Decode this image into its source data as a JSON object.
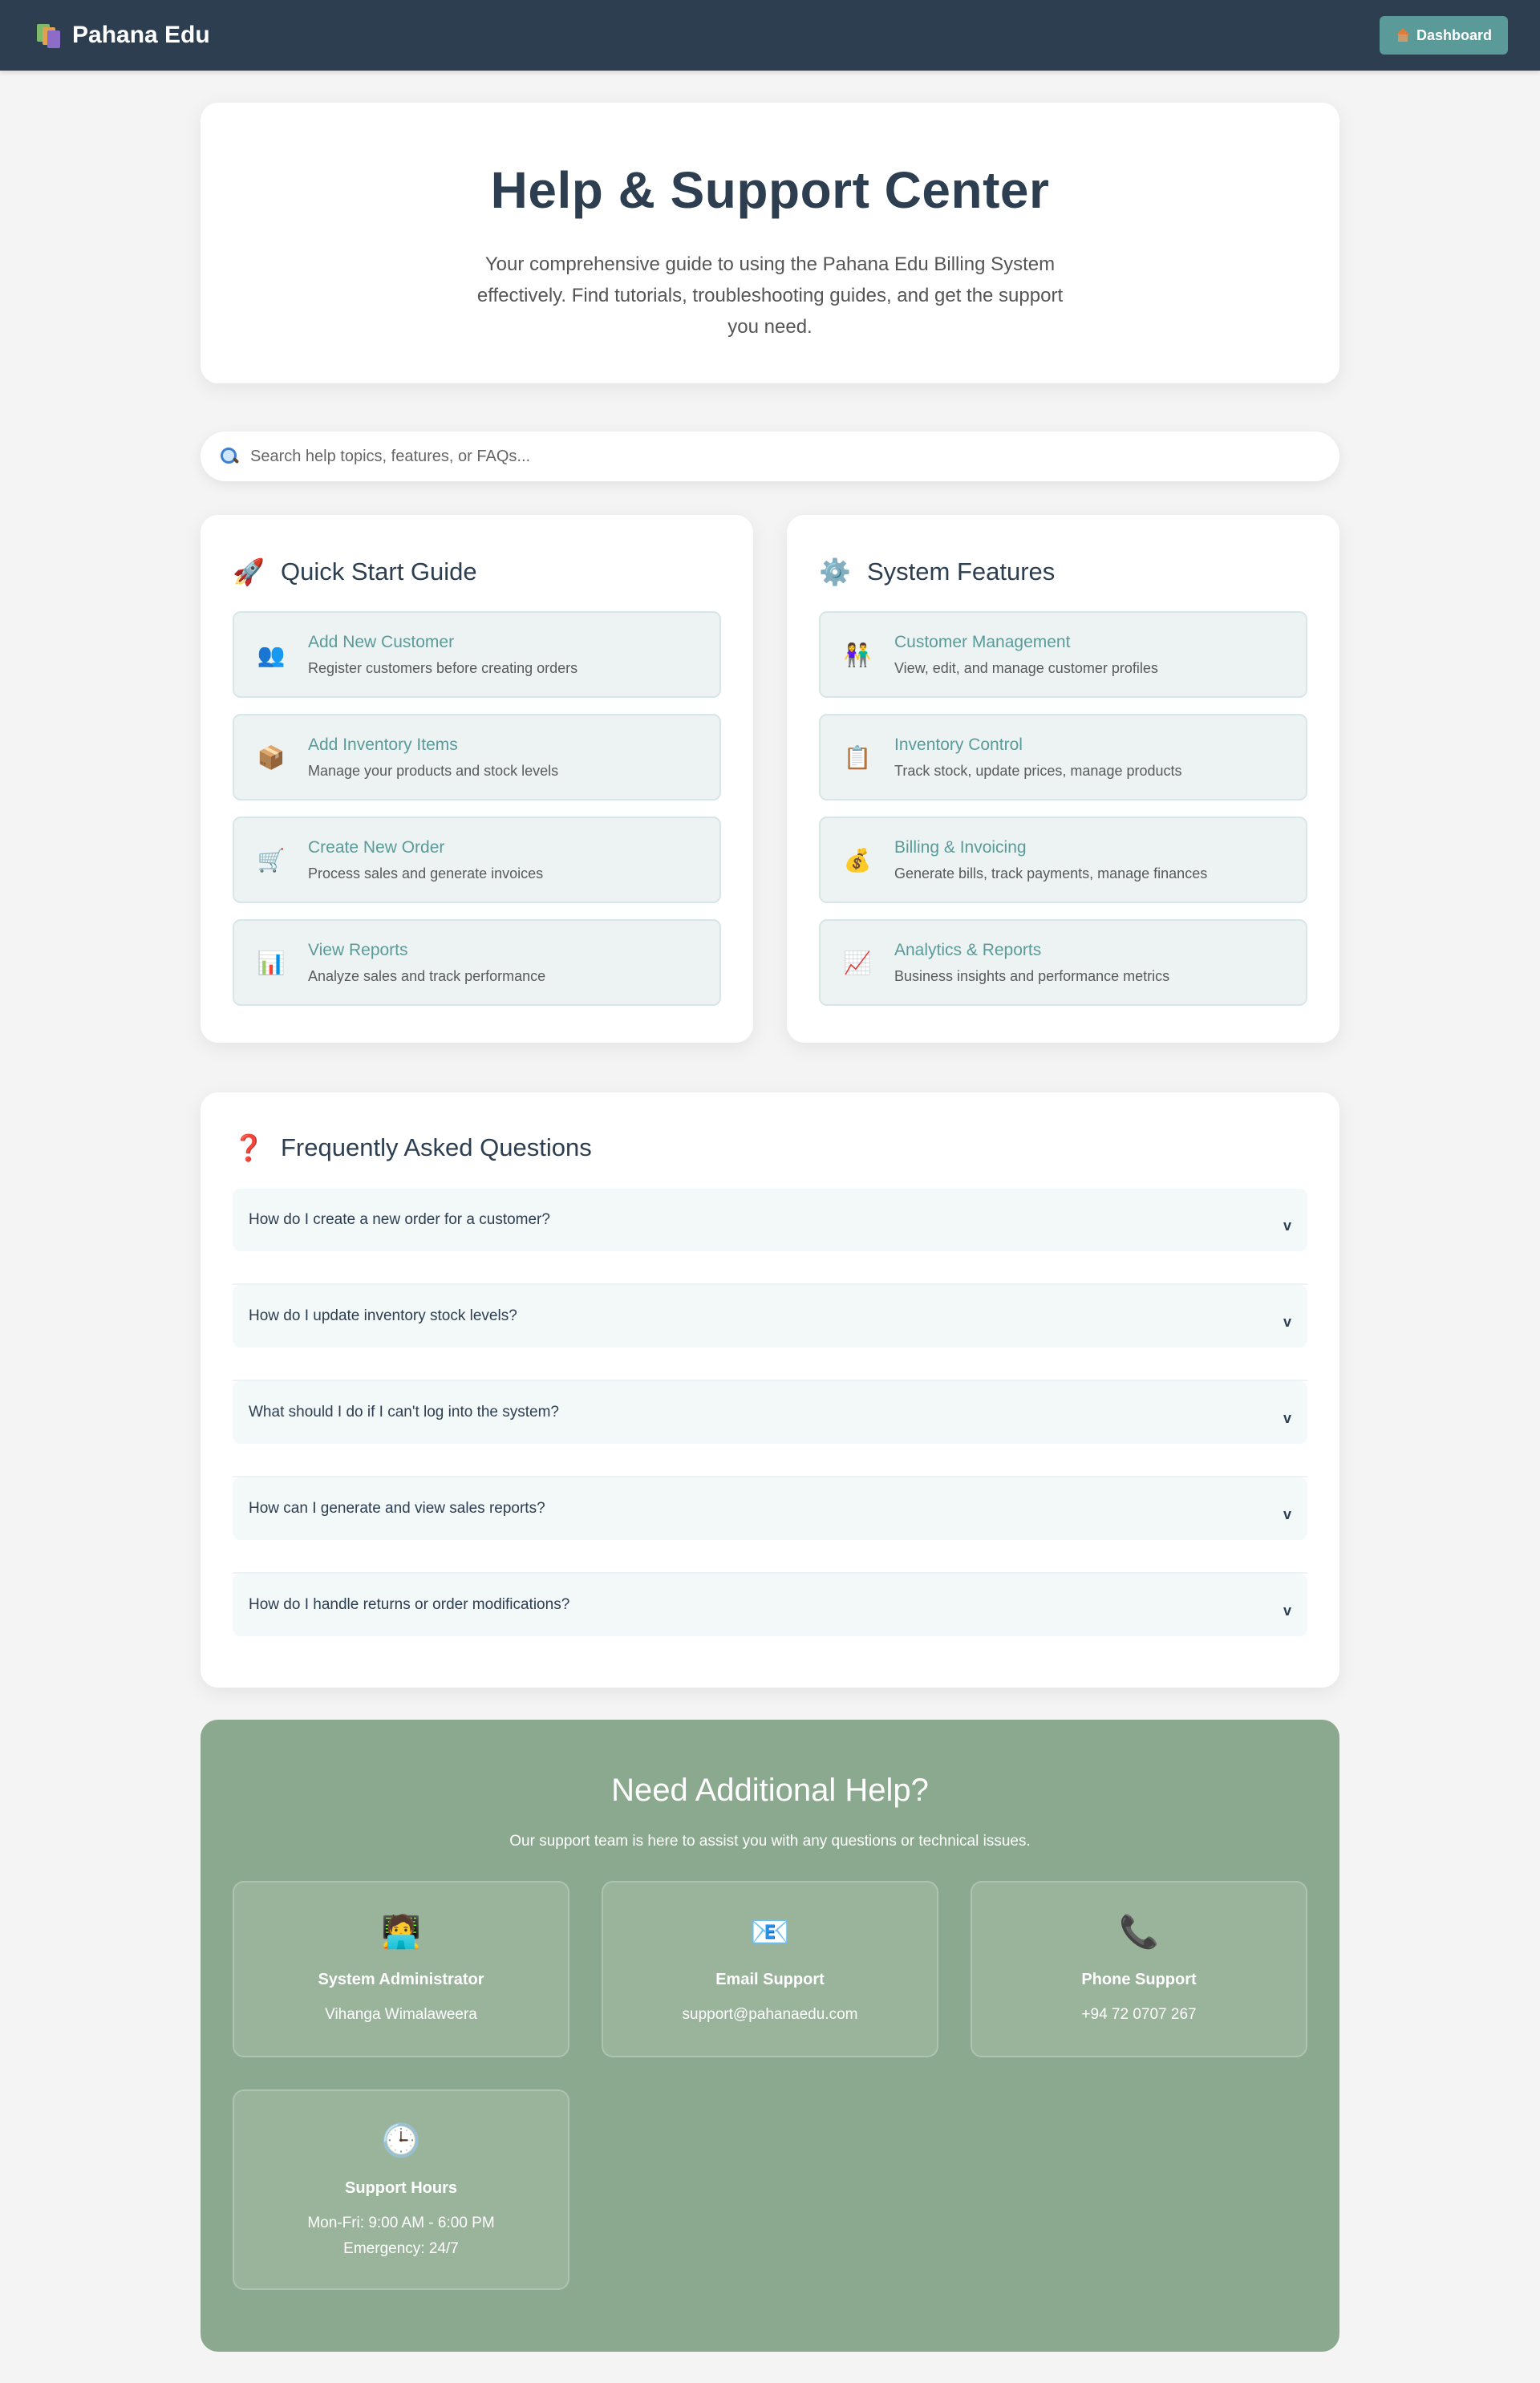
{
  "nav": {
    "brand": "Pahana Edu",
    "dashboard_label": "Dashboard"
  },
  "hero": {
    "title": "Help & Support Center",
    "subtitle": "Your comprehensive guide to using the Pahana Edu Billing System effectively. Find tutorials, troubleshooting guides, and get the support you need."
  },
  "search": {
    "placeholder": "Search help topics, features, or FAQs..."
  },
  "quick_start": {
    "title": "Quick Start Guide",
    "icon": "rocket-icon",
    "items": [
      {
        "title": "Add New Customer",
        "desc": "Register customers before creating orders",
        "icon": "users-icon"
      },
      {
        "title": "Add Inventory Items",
        "desc": "Manage your products and stock levels",
        "icon": "package-icon"
      },
      {
        "title": "Create New Order",
        "desc": "Process sales and generate invoices",
        "icon": "cart-icon"
      },
      {
        "title": "View Reports",
        "desc": "Analyze sales and track performance",
        "icon": "bar-chart-icon"
      }
    ]
  },
  "features": {
    "title": "System Features",
    "icon": "gear-icon",
    "items": [
      {
        "title": "Customer Management",
        "desc": "View, edit, and manage customer profiles",
        "icon": "people-icon"
      },
      {
        "title": "Inventory Control",
        "desc": "Track stock, update prices, manage products",
        "icon": "clipboard-icon"
      },
      {
        "title": "Billing & Invoicing",
        "desc": "Generate bills, track payments, manage finances",
        "icon": "money-bag-icon"
      },
      {
        "title": "Analytics & Reports",
        "desc": "Business insights and performance metrics",
        "icon": "trend-chart-icon"
      }
    ]
  },
  "faq": {
    "title": "Frequently Asked Questions",
    "icon": "question-icon",
    "chevron": "v",
    "items": [
      "How do I create a new order for a customer?",
      "How do I update inventory stock levels?",
      "What should I do if I can't log into the system?",
      "How can I generate and view sales reports?",
      "How do I handle returns or order modifications?"
    ]
  },
  "help": {
    "title": "Need Additional Help?",
    "subtitle": "Our support team is here to assist you with any questions or technical issues.",
    "contacts": [
      {
        "title": "System Administrator",
        "value": "Vihanga Wimalaweera",
        "icon": "technologist-icon"
      },
      {
        "title": "Email Support",
        "value": "support@pahanaedu.com",
        "icon": "email-icon"
      },
      {
        "title": "Phone Support",
        "value": "+94 72 0707 267",
        "icon": "phone-icon"
      },
      {
        "title": "Support Hours",
        "value": "Mon-Fri: 9:00 AM - 6:00 PM",
        "value2": "Emergency: 24/7",
        "icon": "clock-icon"
      }
    ]
  },
  "colors": {
    "navbar": "#2c3e50",
    "accent": "#5a9b9a",
    "help_bg": "#8ba98e",
    "page_bg": "#f4f4f4"
  }
}
